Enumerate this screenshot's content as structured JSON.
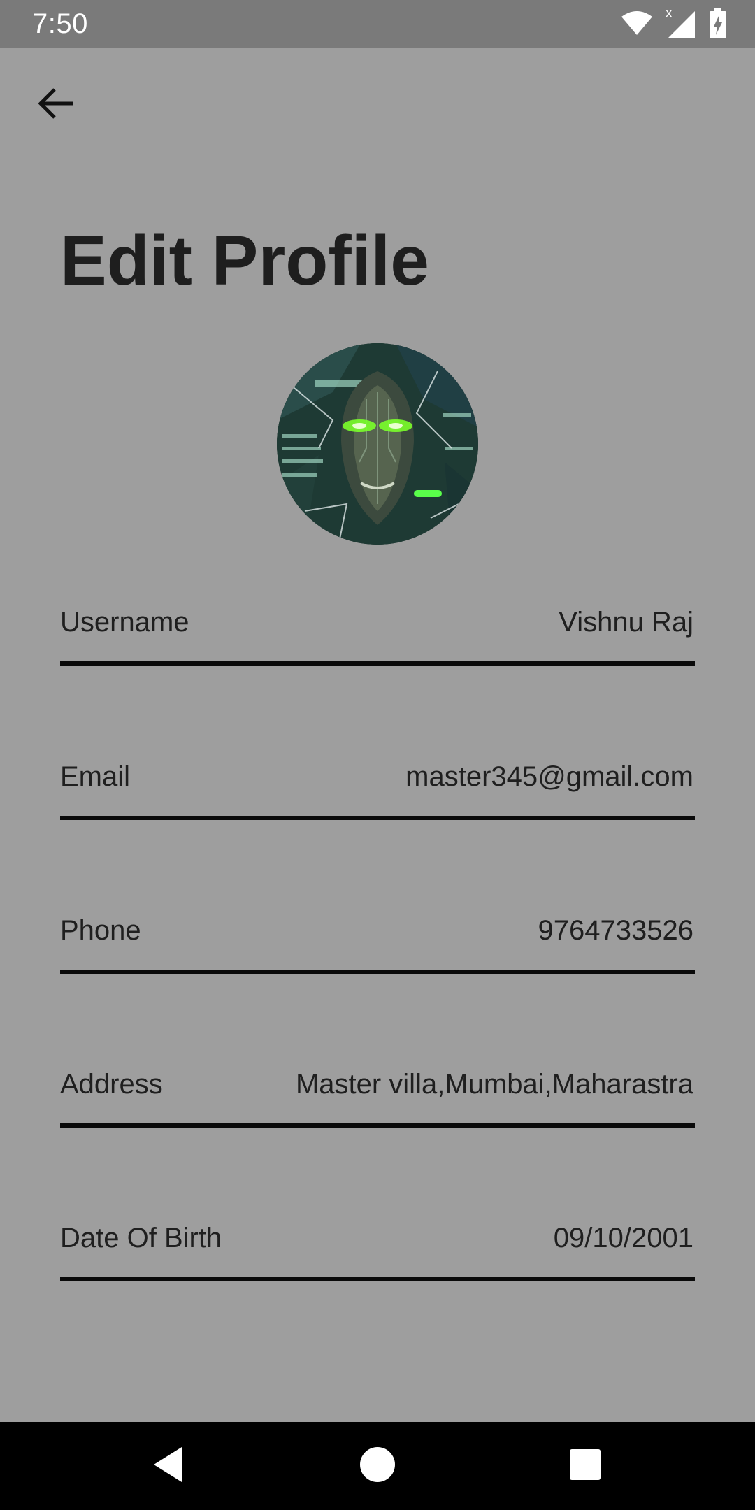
{
  "status_bar": {
    "time": "7:50",
    "icons": [
      "wifi-icon",
      "signal-icon",
      "battery-charging-icon"
    ]
  },
  "header": {
    "back_icon": "arrow-back-icon",
    "title": "Edit Profile"
  },
  "avatar": {
    "icon": "profile-avatar-image"
  },
  "form": {
    "fields": [
      {
        "label": "Username",
        "value": "Vishnu Raj"
      },
      {
        "label": "Email",
        "value": "master345@gmail.com"
      },
      {
        "label": "Phone",
        "value": "9764733526"
      },
      {
        "label": "Address",
        "value": "Master villa,Mumbai,Maharastra"
      },
      {
        "label": "Date Of Birth",
        "value": "09/10/2001"
      }
    ]
  },
  "nav_bar": {
    "icons": [
      "back-triangle-icon",
      "home-circle-icon",
      "recents-square-icon"
    ]
  },
  "colors": {
    "background": "#9e9e9e",
    "status_bar": "#7a7a7a",
    "text": "#1f1f1f",
    "underline": "#0a0a0a",
    "nav_bar": "#000000"
  }
}
